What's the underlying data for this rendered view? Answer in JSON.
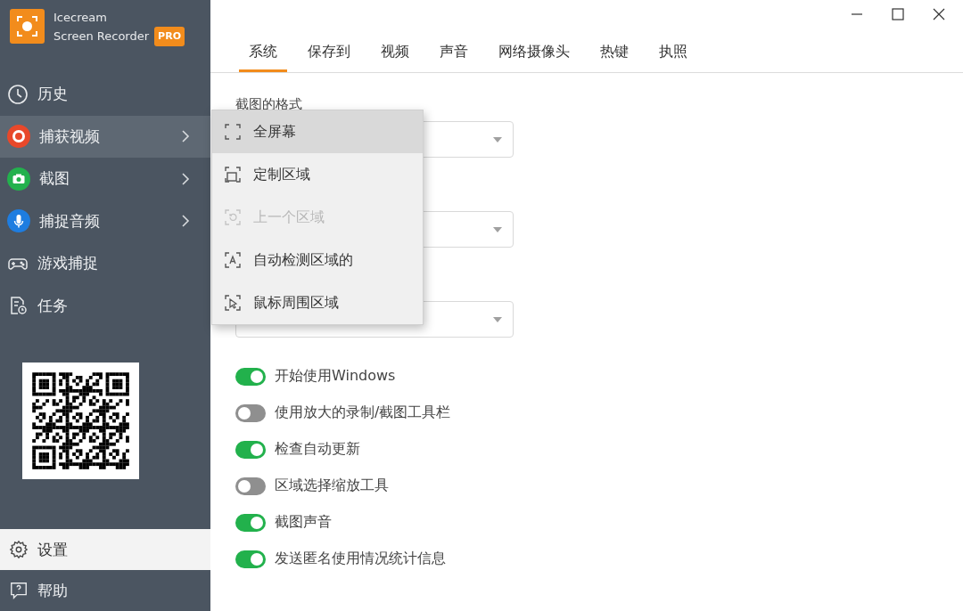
{
  "app": {
    "name": "Icecream",
    "subtitle": "Screen Recorder",
    "badge": "PRO"
  },
  "sidebar": {
    "items": [
      {
        "label": "历史",
        "highlighted": false,
        "submenu": false
      },
      {
        "label": "捕获视频",
        "highlighted": true,
        "submenu": true
      },
      {
        "label": "截图",
        "highlighted": false,
        "submenu": true
      },
      {
        "label": "捕捉音频",
        "highlighted": false,
        "submenu": true
      },
      {
        "label": "游戏捕捉",
        "highlighted": false,
        "submenu": false
      },
      {
        "label": "任务",
        "highlighted": false,
        "submenu": false
      }
    ],
    "bottom_items": [
      {
        "label": "设置",
        "selected": true
      },
      {
        "label": "帮助",
        "selected": false
      }
    ]
  },
  "tabs": [
    {
      "label": "系统",
      "selected": true
    },
    {
      "label": "保存到",
      "selected": false
    },
    {
      "label": "视频",
      "selected": false
    },
    {
      "label": "声音",
      "selected": false
    },
    {
      "label": "网络摄像头",
      "selected": false
    },
    {
      "label": "热键",
      "selected": false
    },
    {
      "label": "执照",
      "selected": false
    }
  ],
  "settings": {
    "label": "截图的格式",
    "dropdowns": [
      {
        "kind": "select"
      },
      {
        "kind": "select"
      },
      {
        "kind": "select"
      }
    ],
    "toggles": [
      {
        "label": "开始使用Windows",
        "on": true
      },
      {
        "label": "使用放大的录制/截图工具栏",
        "on": false
      },
      {
        "label": "检查自动更新",
        "on": true
      },
      {
        "label": "区域选择缩放工具",
        "on": false
      },
      {
        "label": "截图声音",
        "on": true
      },
      {
        "label": "发送匿名使用情况统计信息",
        "on": true
      }
    ]
  },
  "capture_menu": {
    "items": [
      {
        "label": "全屏幕",
        "selected": true,
        "disabled": false
      },
      {
        "label": "定制区域",
        "selected": false,
        "disabled": false
      },
      {
        "label": "上一个区域",
        "selected": false,
        "disabled": true
      },
      {
        "label": "自动检测区域的",
        "selected": false,
        "disabled": false
      },
      {
        "label": "鼠标周围区域",
        "selected": false,
        "disabled": false
      }
    ]
  }
}
